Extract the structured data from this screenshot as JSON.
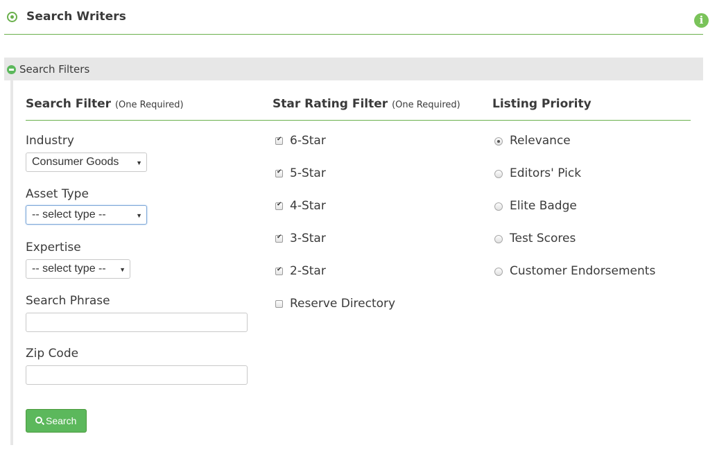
{
  "header": {
    "title": "Search Writers",
    "title_icon": "target-circle-icon",
    "info_icon": "info-icon"
  },
  "filters_bar": {
    "label": "Search Filters",
    "icon": "collapse-minus-icon"
  },
  "colors": {
    "accent_green": "#6ab04c",
    "button_green": "#5cb85c",
    "bar_gray": "#e7e7e7",
    "text": "#3a3a3a"
  },
  "search_filter": {
    "heading": "Search Filter",
    "heading_note": "(One Required)",
    "industry": {
      "label": "Industry",
      "value": "Consumer Goods"
    },
    "asset_type": {
      "label": "Asset Type",
      "value": "-- select type --"
    },
    "expertise": {
      "label": "Expertise",
      "value": "-- select type --"
    },
    "search_phrase": {
      "label": "Search Phrase",
      "value": "",
      "placeholder": ""
    },
    "zip_code": {
      "label": "Zip Code",
      "value": "",
      "placeholder": ""
    },
    "search_button": "Search"
  },
  "star_rating": {
    "heading": "Star Rating Filter",
    "heading_note": "(One Required)",
    "options": [
      {
        "label": "6-Star",
        "checked": true
      },
      {
        "label": "5-Star",
        "checked": true
      },
      {
        "label": "4-Star",
        "checked": true
      },
      {
        "label": "3-Star",
        "checked": true
      },
      {
        "label": "2-Star",
        "checked": true
      },
      {
        "label": "Reserve Directory",
        "checked": false
      }
    ]
  },
  "listing_priority": {
    "heading": "Listing Priority",
    "options": [
      {
        "label": "Relevance",
        "selected": true
      },
      {
        "label": "Editors' Pick",
        "selected": false
      },
      {
        "label": "Elite Badge",
        "selected": false
      },
      {
        "label": "Test Scores",
        "selected": false
      },
      {
        "label": "Customer Endorsements",
        "selected": false
      }
    ]
  }
}
